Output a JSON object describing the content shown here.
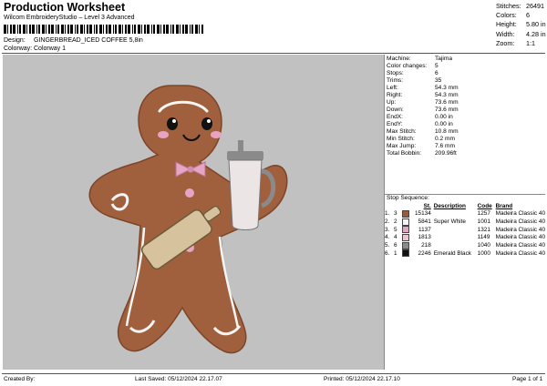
{
  "header": {
    "title": "Production Worksheet",
    "software": "Wilcom EmbroideryStudio – Level 3 Advanced",
    "design_label": "Design:",
    "design_value": "GINGERBREAD_ICED COFFEE 5,8in",
    "colorway_label": "Colorway:",
    "colorway_value": "Colorway 1"
  },
  "stats": [
    {
      "label": "Stitches:",
      "value": "26491"
    },
    {
      "label": "Colors:",
      "value": "6"
    },
    {
      "label": "Height:",
      "value": "5.80 in"
    },
    {
      "label": "Width:",
      "value": "4.28 in"
    },
    {
      "label": "Zoom:",
      "value": "1:1"
    }
  ],
  "machine": [
    {
      "label": "Machine:",
      "value": "Tajima"
    },
    {
      "label": "Color changes:",
      "value": "5"
    },
    {
      "label": "Stops:",
      "value": "6"
    },
    {
      "label": "Trims:",
      "value": "35"
    },
    {
      "label": "Left:",
      "value": "54.3 mm"
    },
    {
      "label": "Right:",
      "value": "54.3 mm"
    },
    {
      "label": "Up:",
      "value": "73.6 mm"
    },
    {
      "label": "Down:",
      "value": "73.6 mm"
    },
    {
      "label": "EndX:",
      "value": "0.00 in"
    },
    {
      "label": "EndY:",
      "value": "0.00 in"
    },
    {
      "label": "Max Stitch:",
      "value": "10.8 mm"
    },
    {
      "label": "Min Stitch:",
      "value": "0.2 mm"
    },
    {
      "label": "Max Jump:",
      "value": "7.6 mm"
    },
    {
      "label": "Total Bobbin:",
      "value": "209.96ft"
    }
  ],
  "stop_sequence": {
    "title": "Stop Sequence:",
    "headers": [
      "",
      "",
      "",
      "St.",
      "Description",
      "Code",
      "Brand"
    ],
    "rows": [
      {
        "num": "1.",
        "n": "3",
        "color": "#9b5a3c",
        "st": "15134",
        "desc": "",
        "code": "1257",
        "brand": "Madeira Classic 40"
      },
      {
        "num": "2.",
        "n": "2",
        "color": "#f4f4f4",
        "st": "5841",
        "desc": "Super White",
        "code": "1001",
        "brand": "Madeira Classic 40"
      },
      {
        "num": "3.",
        "n": "5",
        "color": "#e0a6c4",
        "st": "1137",
        "desc": "",
        "code": "1321",
        "brand": "Madeira Classic 40"
      },
      {
        "num": "4.",
        "n": "4",
        "color": "#ecc3d4",
        "st": "1813",
        "desc": "",
        "code": "1149",
        "brand": "Madeira Classic 40"
      },
      {
        "num": "5.",
        "n": "6",
        "color": "#8a8a8a",
        "st": "218",
        "desc": "",
        "code": "1040",
        "brand": "Madeira Classic 40"
      },
      {
        "num": "6.",
        "n": "1",
        "color": "#111111",
        "st": "2246",
        "desc": "Emerald Black",
        "code": "1000",
        "brand": "Madeira Classic 40"
      }
    ]
  },
  "footer": {
    "created_by": "Created By:",
    "last_saved": "Last Saved: 05/12/2024 22.17.07",
    "printed": "Printed: 05/12/2024 22.17.10",
    "page": "Page 1 of 1"
  }
}
